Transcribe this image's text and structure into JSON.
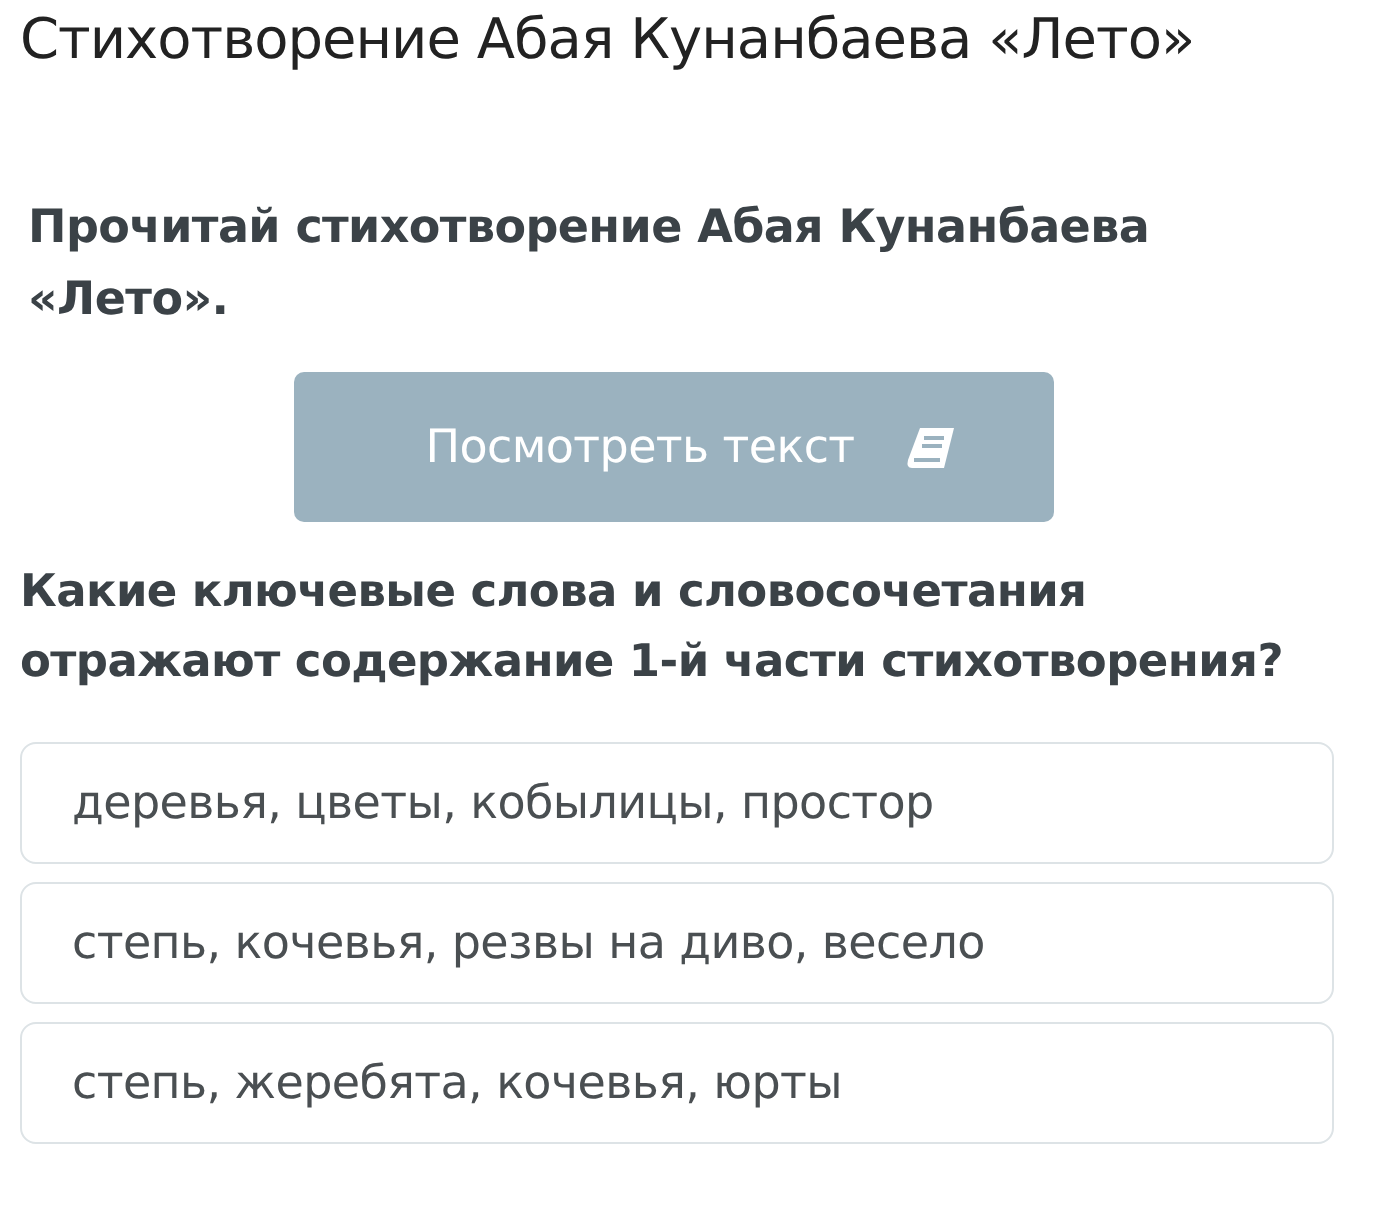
{
  "page_title": "Стихотворение Абая Кунанбаева «Лето»",
  "instruction": "Прочитай стихотворение Абая Кунанбаева «Лето».",
  "view_button": {
    "label": "Посмотреть текст"
  },
  "question": "Какие ключевые слова и словосочетания отражают содержание 1-й части стихотворения?",
  "options": [
    {
      "label": "деревья, цветы, кобылицы, простор",
      "selected": false
    },
    {
      "label": "степь, кочевья, резвы на диво, весело",
      "selected": false
    },
    {
      "label": "степь, жеребята, кочевья, юрты",
      "selected": false
    }
  ]
}
